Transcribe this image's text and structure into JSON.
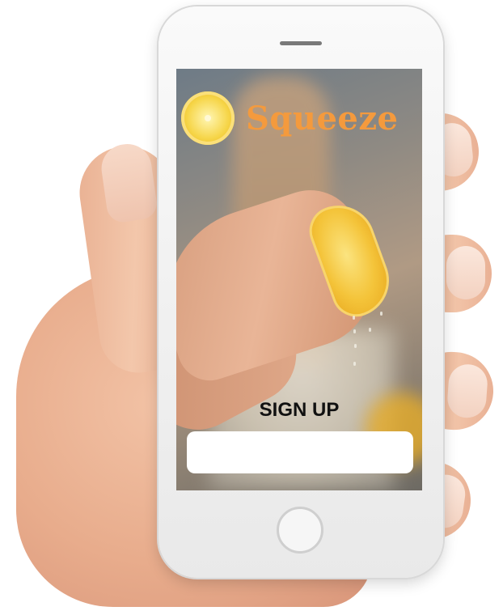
{
  "app": {
    "name": "Squeeze"
  },
  "signup": {
    "label": "SIGN UP",
    "field_value": "",
    "field_placeholder": ""
  },
  "colors": {
    "brand_orange": "#f49a3d",
    "lemon_yellow": "#f4c43a",
    "phone_body": "#f1f1f1",
    "field_background": "#ffffff"
  },
  "icons": {
    "logo": "lemon-slice-icon"
  }
}
